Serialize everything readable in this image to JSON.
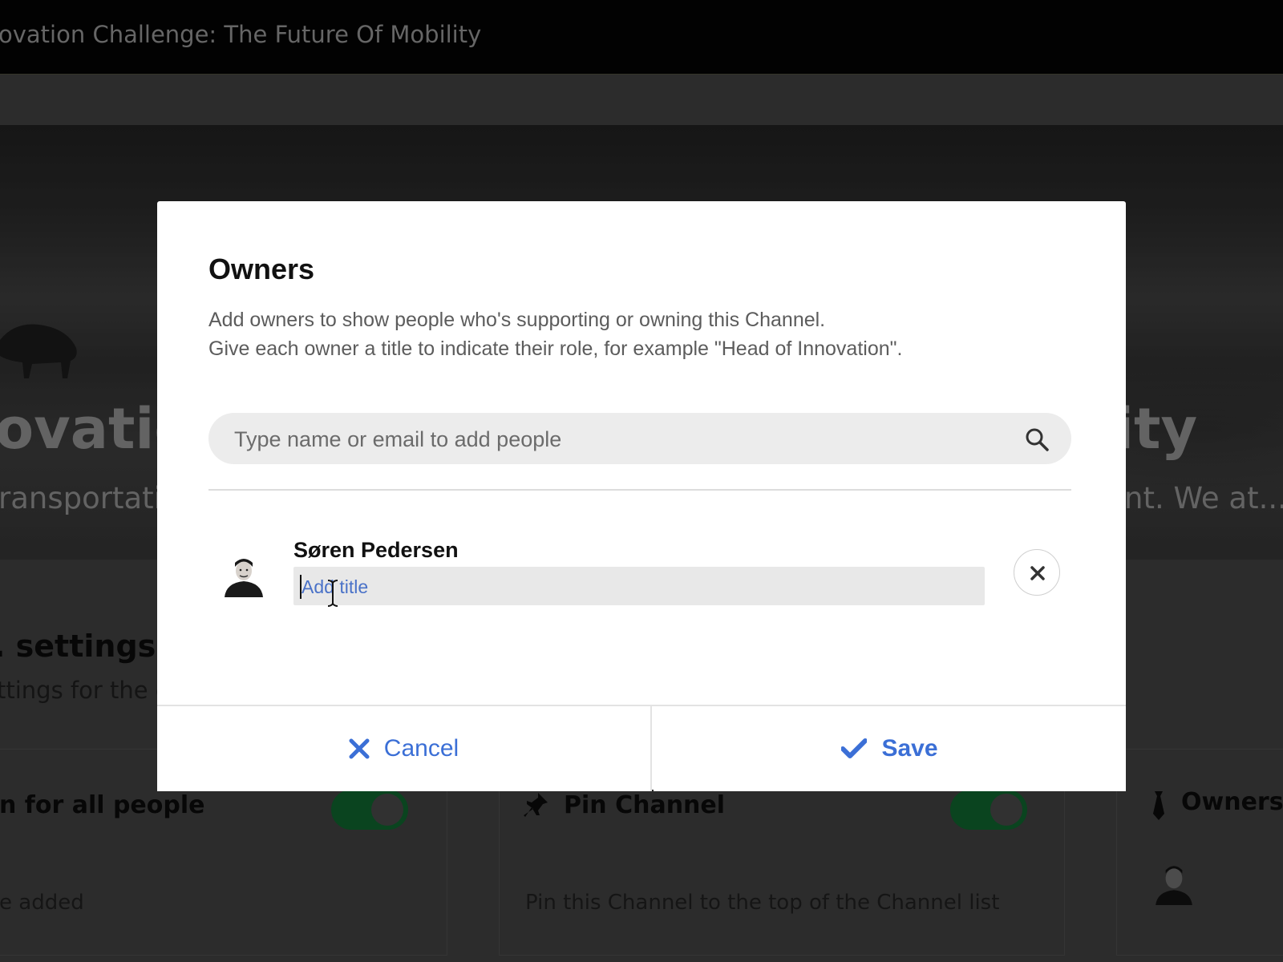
{
  "background": {
    "window_title": "ovation Challenge: The Future Of Mobility",
    "hero_title_left": "ovatio",
    "hero_title_right": "ity",
    "hero_sub_left": "ransportatio",
    "hero_sub_right": "nt. We at...",
    "settings_title": ". settings",
    "settings_sub": "ttings for the e",
    "cards": [
      {
        "title": "n for all people",
        "desc": "e added",
        "toggle_on": true
      },
      {
        "title": "Pin Channel",
        "desc": "Pin this Channel to the top of the Channel list",
        "toggle_on": true
      },
      {
        "title": "Owners",
        "icon": "tie-icon"
      }
    ]
  },
  "modal": {
    "title": "Owners",
    "description_line1": "Add owners to show people who's supporting or owning this Channel.",
    "description_line2": "Give each owner a title to indicate their role, for example \"Head of Innovation\".",
    "search": {
      "placeholder": "Type name or email to add people",
      "value": "",
      "icon": "search-icon"
    },
    "owners": [
      {
        "name": "Søren Pedersen",
        "title_placeholder": "Add title",
        "title_value": ""
      }
    ],
    "buttons": {
      "cancel_label": "Cancel",
      "save_label": "Save"
    }
  },
  "colors": {
    "accent": "#3b6fd6",
    "toggle_on": "#1fa34a",
    "overlay": "#000000"
  }
}
